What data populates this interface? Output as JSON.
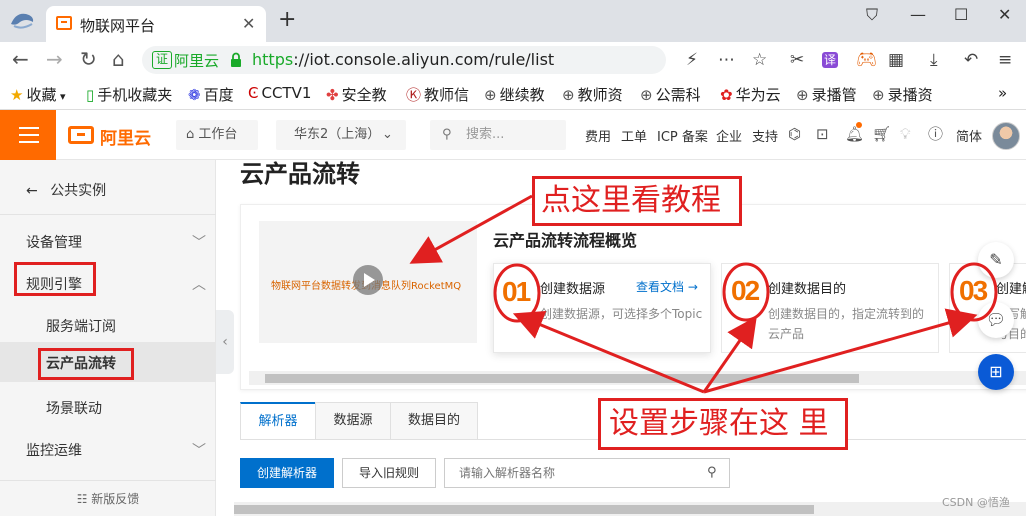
{
  "browser": {
    "tab_title": "物联网平台",
    "tab_close": "✕",
    "new_tab": "+",
    "window_controls": [
      "⛉",
      "—",
      "☐",
      "✕"
    ],
    "site_badge": "证",
    "site_name": "阿里云",
    "url_scheme": "https",
    "url_rest": "://iot.console.aliyun.com/rule/list",
    "toolbar_icons": [
      "bolt-icon",
      "more-icon",
      "cut-icon",
      "translate-icon",
      "game-icon",
      "apps-icon",
      "download-icon",
      "undo-icon",
      "menu-icon"
    ],
    "translate_label": "译",
    "bookmarks": [
      {
        "icon": "★",
        "label": "收藏",
        "color": "#f2a900"
      },
      {
        "icon": "▯",
        "label": "手机收藏夹",
        "color": "#1aaa2a"
      },
      {
        "icon": "❁",
        "label": "百度",
        "color": "#2932e1"
      },
      {
        "icon": "Ͼ",
        "label": "CCTV1",
        "color": "#c00"
      },
      {
        "icon": "✤",
        "label": "安全教",
        "color": "#e04040"
      },
      {
        "icon": "Ⓚ",
        "label": "教师信",
        "color": "#b02020"
      },
      {
        "icon": "⊕",
        "label": "继续教",
        "color": "#555"
      },
      {
        "icon": "⊕",
        "label": "教师资",
        "color": "#555"
      },
      {
        "icon": "⊕",
        "label": "公需科",
        "color": "#555"
      },
      {
        "icon": "✿",
        "label": "华为云",
        "color": "#e02020"
      },
      {
        "icon": "⊕",
        "label": "录播管",
        "color": "#555"
      },
      {
        "icon": "⊕",
        "label": "录播资",
        "color": "#555"
      }
    ],
    "bookmarks_more": "»"
  },
  "header": {
    "logo_text": "阿里云",
    "workbench": "工作台",
    "region": "华东2（上海）",
    "search_placeholder": "搜索...",
    "links": [
      "费用",
      "工单",
      "ICP 备案",
      "企业",
      "支持"
    ],
    "language": "简体"
  },
  "sidebar": {
    "back": "公共实例",
    "groups": [
      {
        "label": "设备管理",
        "chevron": "﹀"
      },
      {
        "label": "规则引擎",
        "chevron": "︿"
      },
      {
        "label": "监控运维",
        "chevron": "﹀"
      }
    ],
    "items": [
      "服务端订阅",
      "云产品流转",
      "场景联动"
    ],
    "active_item": "云产品流转",
    "feedback": "新版反馈"
  },
  "main": {
    "page_title": "云产品流转",
    "video_caption": "物联网平台数据转发到消息队列RocketMQ",
    "overview_title": "云产品流转流程概览",
    "steps": [
      {
        "title": "创建数据源",
        "desc": "创建数据源，可选择多个Topic",
        "link": "查看文档 →"
      },
      {
        "title": "创建数据目的",
        "desc": "创建数据目的，指定流转到的云产品",
        "link": ""
      },
      {
        "title": "创建解析器",
        "desc": "编写解析器脚本，关联数据源与目的",
        "link": ""
      }
    ],
    "tabs": [
      "解析器",
      "数据源",
      "数据目的"
    ],
    "active_tab": "解析器",
    "create_button": "创建解析器",
    "import_button": "导入旧规则",
    "search_placeholder": "请输入解析器名称"
  },
  "annotations": {
    "tutorial": "点这里看教程",
    "steps_here": "设置步骤在这 里",
    "step_numbers": [
      "01",
      "02",
      "03"
    ]
  },
  "watermark": "CSDN @悟渔",
  "colors": {
    "brand": "#ff6a00",
    "primary": "#0070cc",
    "annotation": "#e02020",
    "step_number": "#f07000"
  }
}
